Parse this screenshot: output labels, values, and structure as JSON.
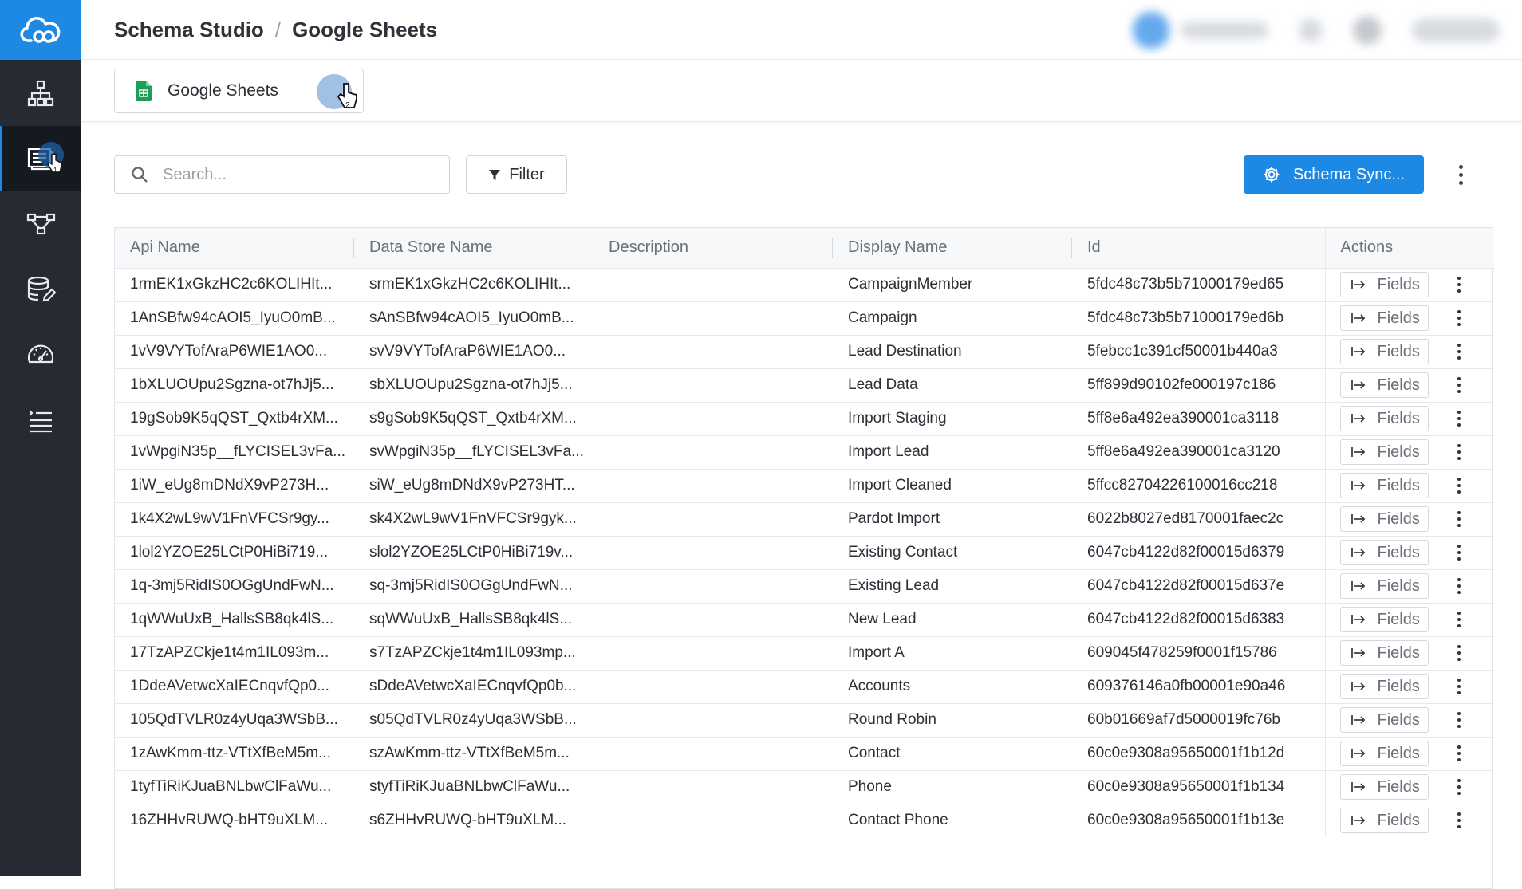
{
  "header": {
    "breadcrumb_root": "Schema Studio",
    "breadcrumb_sep": "/",
    "breadcrumb_current": "Google Sheets"
  },
  "sidebar": {
    "items": [
      {
        "icon": "hierarchy-icon"
      },
      {
        "icon": "schema-list-icon",
        "active": true
      },
      {
        "icon": "flow-icon"
      },
      {
        "icon": "database-edit-icon"
      },
      {
        "icon": "gauge-icon"
      },
      {
        "icon": "task-list-icon"
      }
    ]
  },
  "tab": {
    "label": "Google Sheets",
    "icon": "google-sheets-icon"
  },
  "toolbar": {
    "search_placeholder": "Search...",
    "filter_label": "Filter",
    "sync_label": "Schema Sync..."
  },
  "table": {
    "columns": [
      "Api Name",
      "Data Store Name",
      "Description",
      "Display Name",
      "Id",
      "Actions"
    ],
    "fields_label": "Fields",
    "rows": [
      {
        "api": "1rmEK1xGkzHC2c6KOLIHIt...",
        "store": "srmEK1xGkzHC2c6KOLIHIt...",
        "desc": "",
        "display": "CampaignMember",
        "id": "5fdc48c73b5b71000179ed65"
      },
      {
        "api": "1AnSBfw94cAOI5_IyuO0mB...",
        "store": "sAnSBfw94cAOI5_IyuO0mB...",
        "desc": "",
        "display": "Campaign",
        "id": "5fdc48c73b5b71000179ed6b"
      },
      {
        "api": "1vV9VYTofAraP6WIE1AO0...",
        "store": "svV9VYTofAraP6WIE1AO0...",
        "desc": "",
        "display": "Lead Destination",
        "id": "5febcc1c391cf50001b440a3"
      },
      {
        "api": "1bXLUOUpu2Sgzna-ot7hJj5...",
        "store": "sbXLUOUpu2Sgzna-ot7hJj5...",
        "desc": "",
        "display": "Lead Data",
        "id": "5ff899d90102fe000197c186"
      },
      {
        "api": "19gSob9K5qQST_Qxtb4rXM...",
        "store": "s9gSob9K5qQST_Qxtb4rXM...",
        "desc": "",
        "display": "Import Staging",
        "id": "5ff8e6a492ea390001ca3118"
      },
      {
        "api": "1vWpgiN35p__fLYCISEL3vFa...",
        "store": "svWpgiN35p__fLYCISEL3vFa...",
        "desc": "",
        "display": "Import Lead",
        "id": "5ff8e6a492ea390001ca3120"
      },
      {
        "api": "1iW_eUg8mDNdX9vP273H...",
        "store": "siW_eUg8mDNdX9vP273HT...",
        "desc": "",
        "display": "Import Cleaned",
        "id": "5ffcc82704226100016cc218"
      },
      {
        "api": "1k4X2wL9wV1FnVFCSr9gy...",
        "store": "sk4X2wL9wV1FnVFCSr9gyk...",
        "desc": "",
        "display": "Pardot Import",
        "id": "6022b8027ed8170001faec2c"
      },
      {
        "api": "1lol2YZOE25LCtP0HiBi719...",
        "store": "slol2YZOE25LCtP0HiBi719v...",
        "desc": "",
        "display": "Existing Contact",
        "id": "6047cb4122d82f00015d6379"
      },
      {
        "api": "1q-3mj5RidIS0OGgUndFwN...",
        "store": "sq-3mj5RidIS0OGgUndFwN...",
        "desc": "",
        "display": "Existing Lead",
        "id": "6047cb4122d82f00015d637e"
      },
      {
        "api": "1qWWuUxB_HallsSB8qk4lS...",
        "store": "sqWWuUxB_HallsSB8qk4lS...",
        "desc": "",
        "display": "New Lead",
        "id": "6047cb4122d82f00015d6383"
      },
      {
        "api": "17TzAPZCkje1t4m1IL093m...",
        "store": "s7TzAPZCkje1t4m1IL093mp...",
        "desc": "",
        "display": "Import A",
        "id": "609045f478259f0001f15786"
      },
      {
        "api": "1DdeAVetwcXaIECnqvfQp0...",
        "store": "sDdeAVetwcXaIECnqvfQp0b...",
        "desc": "",
        "display": "Accounts",
        "id": "609376146a0fb00001e90a46"
      },
      {
        "api": "105QdTVLR0z4yUqa3WSbB...",
        "store": "s05QdTVLR0z4yUqa3WSbB...",
        "desc": "",
        "display": "Round Robin",
        "id": "60b01669af7d5000019fc76b"
      },
      {
        "api": "1zAwKmm-ttz-VTtXfBeM5m...",
        "store": "szAwKmm-ttz-VTtXfBeM5m...",
        "desc": "",
        "display": "Contact",
        "id": "60c0e9308a95650001f1b12d"
      },
      {
        "api": "1tyfTiRiKJuaBNLbwClFaWu...",
        "store": "styfTiRiKJuaBNLbwClFaWu...",
        "desc": "",
        "display": "Phone",
        "id": "60c0e9308a95650001f1b134"
      },
      {
        "api": "16ZHHvRUWQ-bHT9uXLM...",
        "store": "s6ZHHvRUWQ-bHT9uXLM...",
        "desc": "",
        "display": "Contact Phone",
        "id": "60c0e9308a95650001f1b13e"
      }
    ]
  },
  "colors": {
    "accent": "#1e88e5",
    "sidebar": "#252a33",
    "sheets_green": "#1e9e54"
  }
}
